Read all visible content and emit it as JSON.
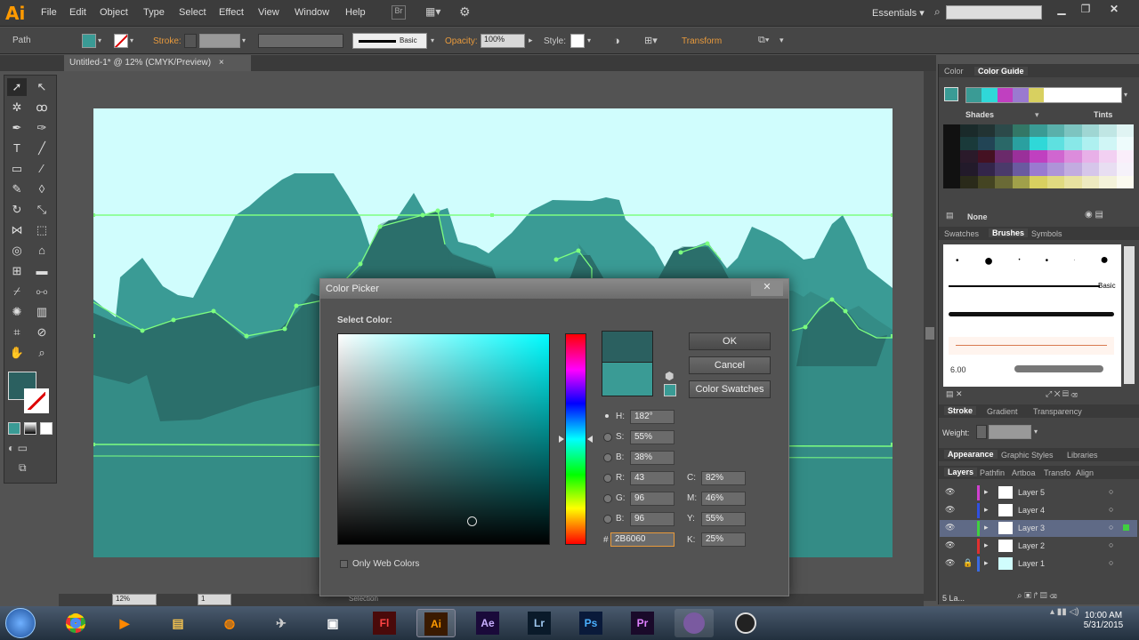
{
  "app": {
    "logo": "Ai",
    "workspace": "Essentials",
    "search_placeholder": ""
  },
  "menu": [
    "File",
    "Edit",
    "Object",
    "Type",
    "Select",
    "Effect",
    "View",
    "Window",
    "Help"
  ],
  "control_bar": {
    "selection": "Path",
    "stroke_label": "Stroke:",
    "brush": "Basic",
    "opacity_label": "Opacity:",
    "opacity": "100%",
    "style_label": "Style:",
    "transform": "Transform"
  },
  "document": {
    "tab": "Untitled-1* @ 12% (CMYK/Preview)",
    "zoom": "12%",
    "artboard": "1",
    "status": "Selection"
  },
  "right_panel": {
    "tabs_top": [
      "Color",
      "Color Guide"
    ],
    "shades": "Shades",
    "tints": "Tints",
    "none_label": "None",
    "tabs_brush": [
      "Swatches",
      "Brushes",
      "Symbols"
    ],
    "brush_basic": "Basic",
    "brush_size": "6.00",
    "tabs_stroke": [
      "Stroke",
      "Gradient",
      "Transparency"
    ],
    "weight_label": "Weight:",
    "tabs_appearance": [
      "Appearance",
      "Graphic Styles",
      "Libraries"
    ],
    "tabs_layers": [
      "Layers",
      "Pathfin",
      "Artboa",
      "Transfo",
      "Align"
    ],
    "layers": [
      "Layer 5",
      "Layer 4",
      "Layer 3",
      "Layer 2",
      "Layer 1"
    ],
    "layer_count": "5 La..."
  },
  "color_picker": {
    "title": "Color Picker",
    "select_color": "Select Color:",
    "ok": "OK",
    "cancel": "Cancel",
    "swatches": "Color Swatches",
    "H": "182°",
    "S": "55%",
    "B": "38%",
    "R": "43",
    "G": "96",
    "Bv": "96",
    "C": "82%",
    "M": "46%",
    "Y": "55%",
    "K": "25%",
    "hex": "2B6060",
    "only_web": "Only Web Colors",
    "labels": {
      "H": "H:",
      "S": "S:",
      "B": "B:",
      "R": "R:",
      "G": "G:",
      "Bv": "B:",
      "C": "C:",
      "M": "M:",
      "Y": "Y:",
      "K": "K:",
      "hash": "#"
    }
  },
  "colors": {
    "new": "#2b6060",
    "old": "#3a9b95",
    "sky": "#d0fdfd",
    "mountain": "#3a9b95",
    "dark_mountain": "#2b6f6b"
  },
  "taskbar": {
    "apps": [
      "Fl",
      "Ai",
      "Ae",
      "Lr",
      "Ps",
      "Pr"
    ],
    "time": "10:00 AM",
    "date": "5/31/2015"
  }
}
